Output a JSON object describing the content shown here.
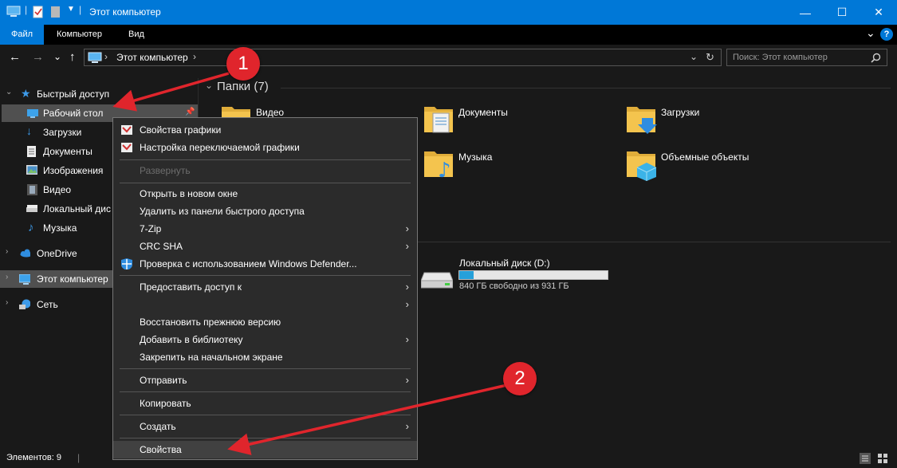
{
  "window": {
    "title": "Этот компьютер",
    "controls": {
      "minimize": "—",
      "maximize": "☐",
      "close": "✕"
    }
  },
  "ribbon": {
    "tabs": [
      "Файл",
      "Компьютер",
      "Вид"
    ],
    "collapse": "⌄",
    "help": "?"
  },
  "navbar": {
    "back": "←",
    "forward": "→",
    "recent": "⌄",
    "up": "↑",
    "address_path": "Этот компьютер",
    "address_chevron": "›",
    "dropdown": "⌄",
    "refresh": "↻"
  },
  "search": {
    "placeholder": "Поиск: Этот компьютер"
  },
  "sidebar": {
    "quick_access": "Быстрый доступ",
    "items": [
      {
        "label": "Рабочий стол"
      },
      {
        "label": "Загрузки"
      },
      {
        "label": "Документы"
      },
      {
        "label": "Изображения"
      },
      {
        "label": "Видео"
      },
      {
        "label": "Локальный дис"
      },
      {
        "label": "Музыка"
      }
    ],
    "onedrive": "OneDrive",
    "this_pc": "Этот компьютер",
    "network": "Сеть"
  },
  "content": {
    "folders_header": "Папки (7)",
    "folders": [
      {
        "label": "Видео"
      },
      {
        "label": "Документы"
      },
      {
        "label": "Загрузки"
      },
      {
        "label": "Музыка"
      },
      {
        "label": "Объемные объекты"
      }
    ],
    "drive": {
      "name": "Локальный диск (D:)",
      "free_text": "840 ГБ свободно из 931 ГБ",
      "used_fraction": 0.098
    }
  },
  "context_menu": {
    "items": [
      {
        "label": "Свойства графики"
      },
      {
        "label": "Настройка переключаемой графики"
      },
      {
        "label": "Развернуть"
      },
      {
        "label": "Открыть в новом окне"
      },
      {
        "label": "Удалить из панели быстрого доступа"
      },
      {
        "label": "7-Zip"
      },
      {
        "label": "CRC SHA"
      },
      {
        "label": "Проверка с использованием Windows Defender..."
      },
      {
        "label": "Предоставить доступ к"
      },
      {
        "label": ""
      },
      {
        "label": "Восстановить прежнюю версию"
      },
      {
        "label": "Добавить в библиотеку"
      },
      {
        "label": "Закрепить на начальном экране"
      },
      {
        "label": "Отправить"
      },
      {
        "label": "Копировать"
      },
      {
        "label": "Создать"
      },
      {
        "label": "Свойства"
      }
    ],
    "submenu_arrow": "›"
  },
  "statusbar": {
    "count": "Элементов: 9"
  },
  "annotations": {
    "badge1": "1",
    "badge2": "2"
  },
  "colors": {
    "accent": "#0078d7",
    "annotation": "#e0252c",
    "folder": "#f4c44e"
  }
}
